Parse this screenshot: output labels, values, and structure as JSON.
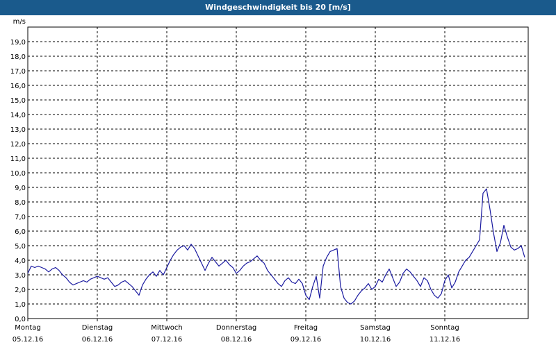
{
  "header": {
    "title": "Windgeschwindigkeit bis 20 [m/s]"
  },
  "chart_data": {
    "type": "line",
    "title": "Windgeschwindigkeit bis 20 [m/s]",
    "ylabel": "m/s",
    "ylim": [
      0,
      20
    ],
    "y_ticks": [
      "0,0",
      "1,0",
      "2,0",
      "3,0",
      "4,0",
      "5,0",
      "6,0",
      "7,0",
      "8,0",
      "9,0",
      "10,0",
      "11,0",
      "12,0",
      "13,0",
      "14,0",
      "15,0",
      "16,0",
      "17,0",
      "18,0",
      "19,0"
    ],
    "x_labels": [
      {
        "day": "Montag",
        "date": "05.12.16"
      },
      {
        "day": "Dienstag",
        "date": "06.12.16"
      },
      {
        "day": "Mittwoch",
        "date": "07.12.16"
      },
      {
        "day": "Donnerstag",
        "date": "08.12.16"
      },
      {
        "day": "Freitag",
        "date": "09.12.16"
      },
      {
        "day": "Samstag",
        "date": "10.12.16"
      },
      {
        "day": "Sonntag",
        "date": "11.12.16"
      }
    ],
    "grid": true,
    "line_color": "#1a1aa0",
    "series": [
      {
        "x": [
          0,
          0.05,
          0.1,
          0.15,
          0.2,
          0.25,
          0.3,
          0.35,
          0.4,
          0.45,
          0.5,
          0.55,
          0.6,
          0.65,
          0.7,
          0.75,
          0.8,
          0.85,
          0.9,
          0.95,
          1.0,
          1.05,
          1.1,
          1.15,
          1.2,
          1.25,
          1.3,
          1.35,
          1.4,
          1.45,
          1.5,
          1.55,
          1.6,
          1.65,
          1.7,
          1.75,
          1.8,
          1.85,
          1.9,
          1.95,
          2.0,
          2.05,
          2.1,
          2.15,
          2.2,
          2.25,
          2.3,
          2.35,
          2.4,
          2.45,
          2.5,
          2.55,
          2.6,
          2.65,
          2.7,
          2.75,
          2.8,
          2.85,
          2.9,
          2.95,
          3.0,
          3.05,
          3.1,
          3.15,
          3.2,
          3.25,
          3.3,
          3.35,
          3.4,
          3.45,
          3.5,
          3.55,
          3.6,
          3.65,
          3.7,
          3.75,
          3.8,
          3.85,
          3.9,
          3.95,
          4.0,
          4.05,
          4.1,
          4.15,
          4.2,
          4.25,
          4.3,
          4.35,
          4.4,
          4.45,
          4.5,
          4.55,
          4.6,
          4.65,
          4.7,
          4.75,
          4.8,
          4.85,
          4.9,
          4.95,
          5.0,
          5.05,
          5.1,
          5.15,
          5.2,
          5.25,
          5.3,
          5.35,
          5.4,
          5.45,
          5.5,
          5.55,
          5.6,
          5.65,
          5.7,
          5.75,
          5.8,
          5.85,
          5.9,
          5.95,
          6.0,
          6.05,
          6.1,
          6.15,
          6.2,
          6.25,
          6.3,
          6.35,
          6.4,
          6.45,
          6.5,
          6.55,
          6.6,
          6.65,
          6.7,
          6.75,
          6.8,
          6.85,
          6.9,
          6.95,
          7.0,
          7.05,
          7.1,
          7.15
        ],
        "y": [
          3.1,
          3.6,
          3.5,
          3.6,
          3.5,
          3.4,
          3.2,
          3.4,
          3.5,
          3.3,
          3.0,
          2.8,
          2.5,
          2.3,
          2.4,
          2.5,
          2.6,
          2.5,
          2.7,
          2.8,
          2.9,
          2.8,
          2.7,
          2.8,
          2.5,
          2.2,
          2.3,
          2.5,
          2.6,
          2.4,
          2.2,
          1.9,
          1.6,
          2.3,
          2.7,
          3.0,
          3.2,
          2.9,
          3.3,
          3.0,
          3.5,
          4.0,
          4.4,
          4.7,
          4.9,
          5.0,
          4.7,
          5.1,
          4.8,
          4.3,
          3.8,
          3.3,
          3.8,
          4.2,
          3.9,
          3.6,
          3.8,
          4.0,
          3.7,
          3.5,
          3.1,
          3.3,
          3.6,
          3.8,
          3.9,
          4.1,
          4.3,
          4.0,
          3.8,
          3.3,
          3.0,
          2.7,
          2.4,
          2.2,
          2.6,
          2.8,
          2.5,
          2.4,
          2.7,
          2.4,
          1.6,
          1.3,
          2.2,
          2.9,
          1.4,
          3.6,
          4.2,
          4.6,
          4.7,
          4.8,
          2.2,
          1.4,
          1.1,
          1.0,
          1.2,
          1.6,
          1.9,
          2.1,
          2.4,
          2.0,
          2.2,
          2.7,
          2.5,
          3.0,
          3.4,
          2.8,
          2.2,
          2.5,
          3.1,
          3.4,
          3.2,
          2.9,
          2.6,
          2.2,
          2.8,
          2.6,
          2.0,
          1.6,
          1.4,
          1.7,
          2.6,
          3.0,
          2.1,
          2.5,
          3.2,
          3.6,
          4.0,
          4.2,
          4.6,
          5.0,
          5.4,
          8.6,
          8.9,
          7.5,
          5.9,
          4.6,
          5.2,
          6.4,
          5.6,
          4.9,
          4.7,
          4.8,
          5.0,
          4.2
        ]
      }
    ]
  }
}
